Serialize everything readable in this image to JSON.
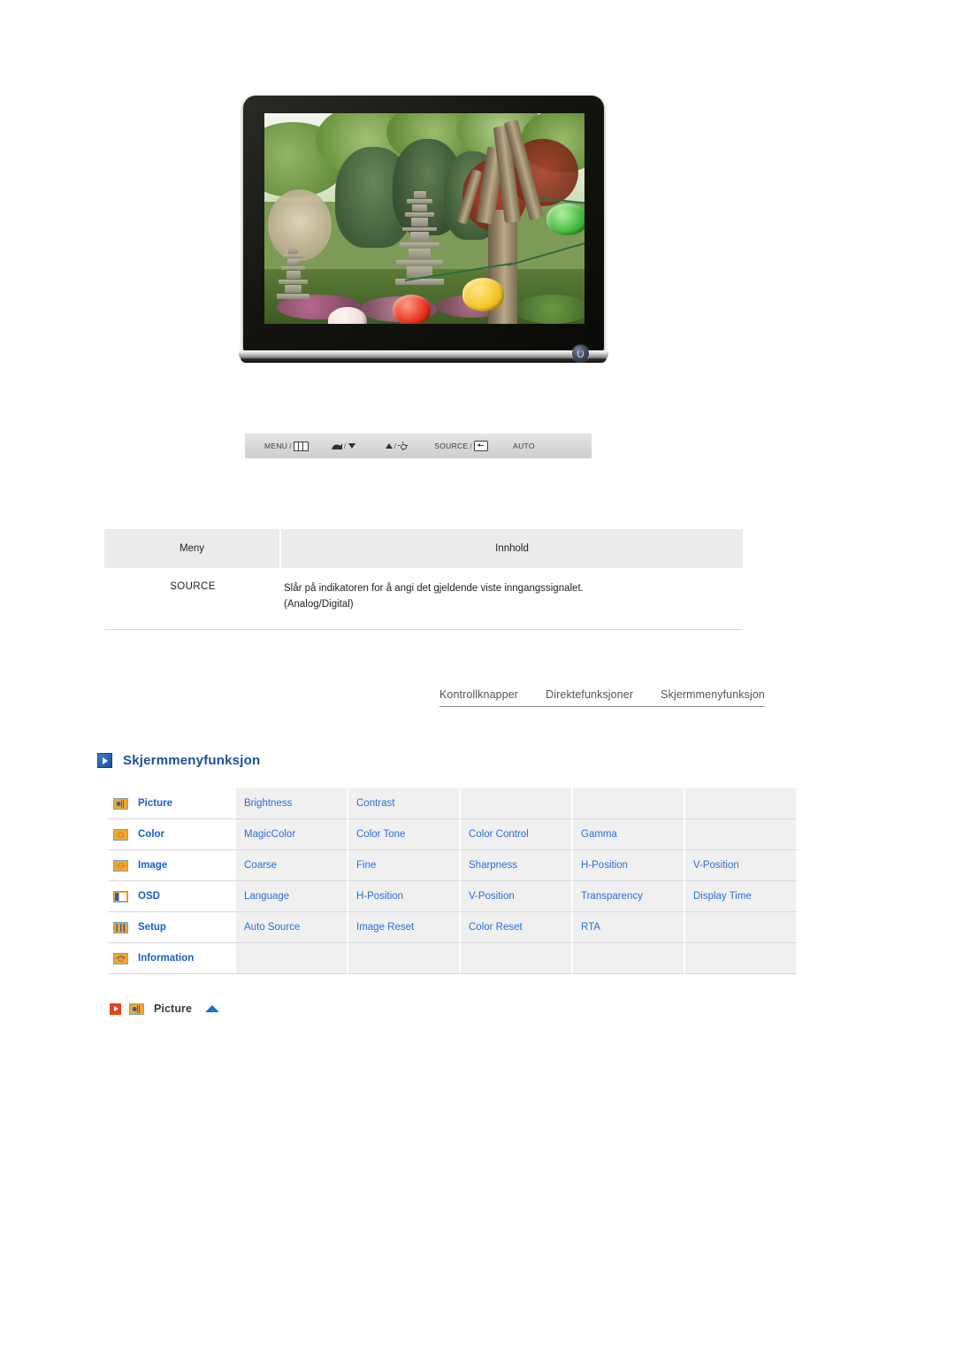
{
  "monitor": {
    "alt": "Samsung LCD monitor displaying a Korean garden scene with stone pagodas and paper lanterns",
    "power_button_name": "power-button"
  },
  "control_panel": {
    "items": [
      {
        "label": "MENU",
        "separator": "/",
        "icon": "menu-bars-icon"
      },
      {
        "label": "",
        "separator": "/",
        "icon": "brightness-gauge-icon",
        "icon2": "triangle-down-icon"
      },
      {
        "label": "",
        "separator": "/",
        "icon": "triangle-up-icon",
        "icon2": "sun-brightness-icon"
      },
      {
        "label": "SOURCE",
        "separator": "/",
        "icon": "enter-key-icon"
      },
      {
        "label": "AUTO",
        "separator": "",
        "icon": ""
      }
    ]
  },
  "meny_table": {
    "headers": {
      "col1": "Meny",
      "col2": "Innhold"
    },
    "rows": [
      {
        "meny": "SOURCE",
        "innhold_line1": "Slår på indikatoren for å angi det gjeldende viste inngangssignalet.",
        "innhold_line2": "(Analog/Digital)"
      }
    ]
  },
  "tabs": [
    {
      "label": "Kontrollknapper",
      "active": false
    },
    {
      "label": "Direktefunksjoner",
      "active": false
    },
    {
      "label": "Skjermmenyfunksjon",
      "active": true
    }
  ],
  "section": {
    "heading": "Skjermmenyfunksjon",
    "heading_icon": "blue-play-square-icon",
    "accent_color": "#1a4f9c"
  },
  "osd_matrix": {
    "link_color": "#2a6fd4",
    "rows": [
      {
        "icon": "picture-icon",
        "category": "Picture",
        "options": [
          "Brightness",
          "Contrast",
          "",
          "",
          ""
        ]
      },
      {
        "icon": "color-icon",
        "category": "Color",
        "options": [
          "MagicColor",
          "Color Tone",
          "Color Control",
          "Gamma",
          ""
        ]
      },
      {
        "icon": "image-icon",
        "category": "Image",
        "options": [
          "Coarse",
          "Fine",
          "Sharpness",
          "H-Position",
          "V-Position"
        ]
      },
      {
        "icon": "osd-icon",
        "category": "OSD",
        "options": [
          "Language",
          "H-Position",
          "V-Position",
          "Transparency",
          "Display Time"
        ]
      },
      {
        "icon": "setup-icon",
        "category": "Setup",
        "options": [
          "Auto Source",
          "Image Reset",
          "Color Reset",
          "RTA",
          ""
        ]
      },
      {
        "icon": "information-icon",
        "category": "Information",
        "options": [
          "",
          "",
          "",
          "",
          ""
        ]
      }
    ]
  },
  "picture_anchor": {
    "play_icon": "red-play-icon",
    "item_icon": "picture-icon",
    "label": "Picture",
    "up_icon": "blue-up-triangle-icon"
  }
}
